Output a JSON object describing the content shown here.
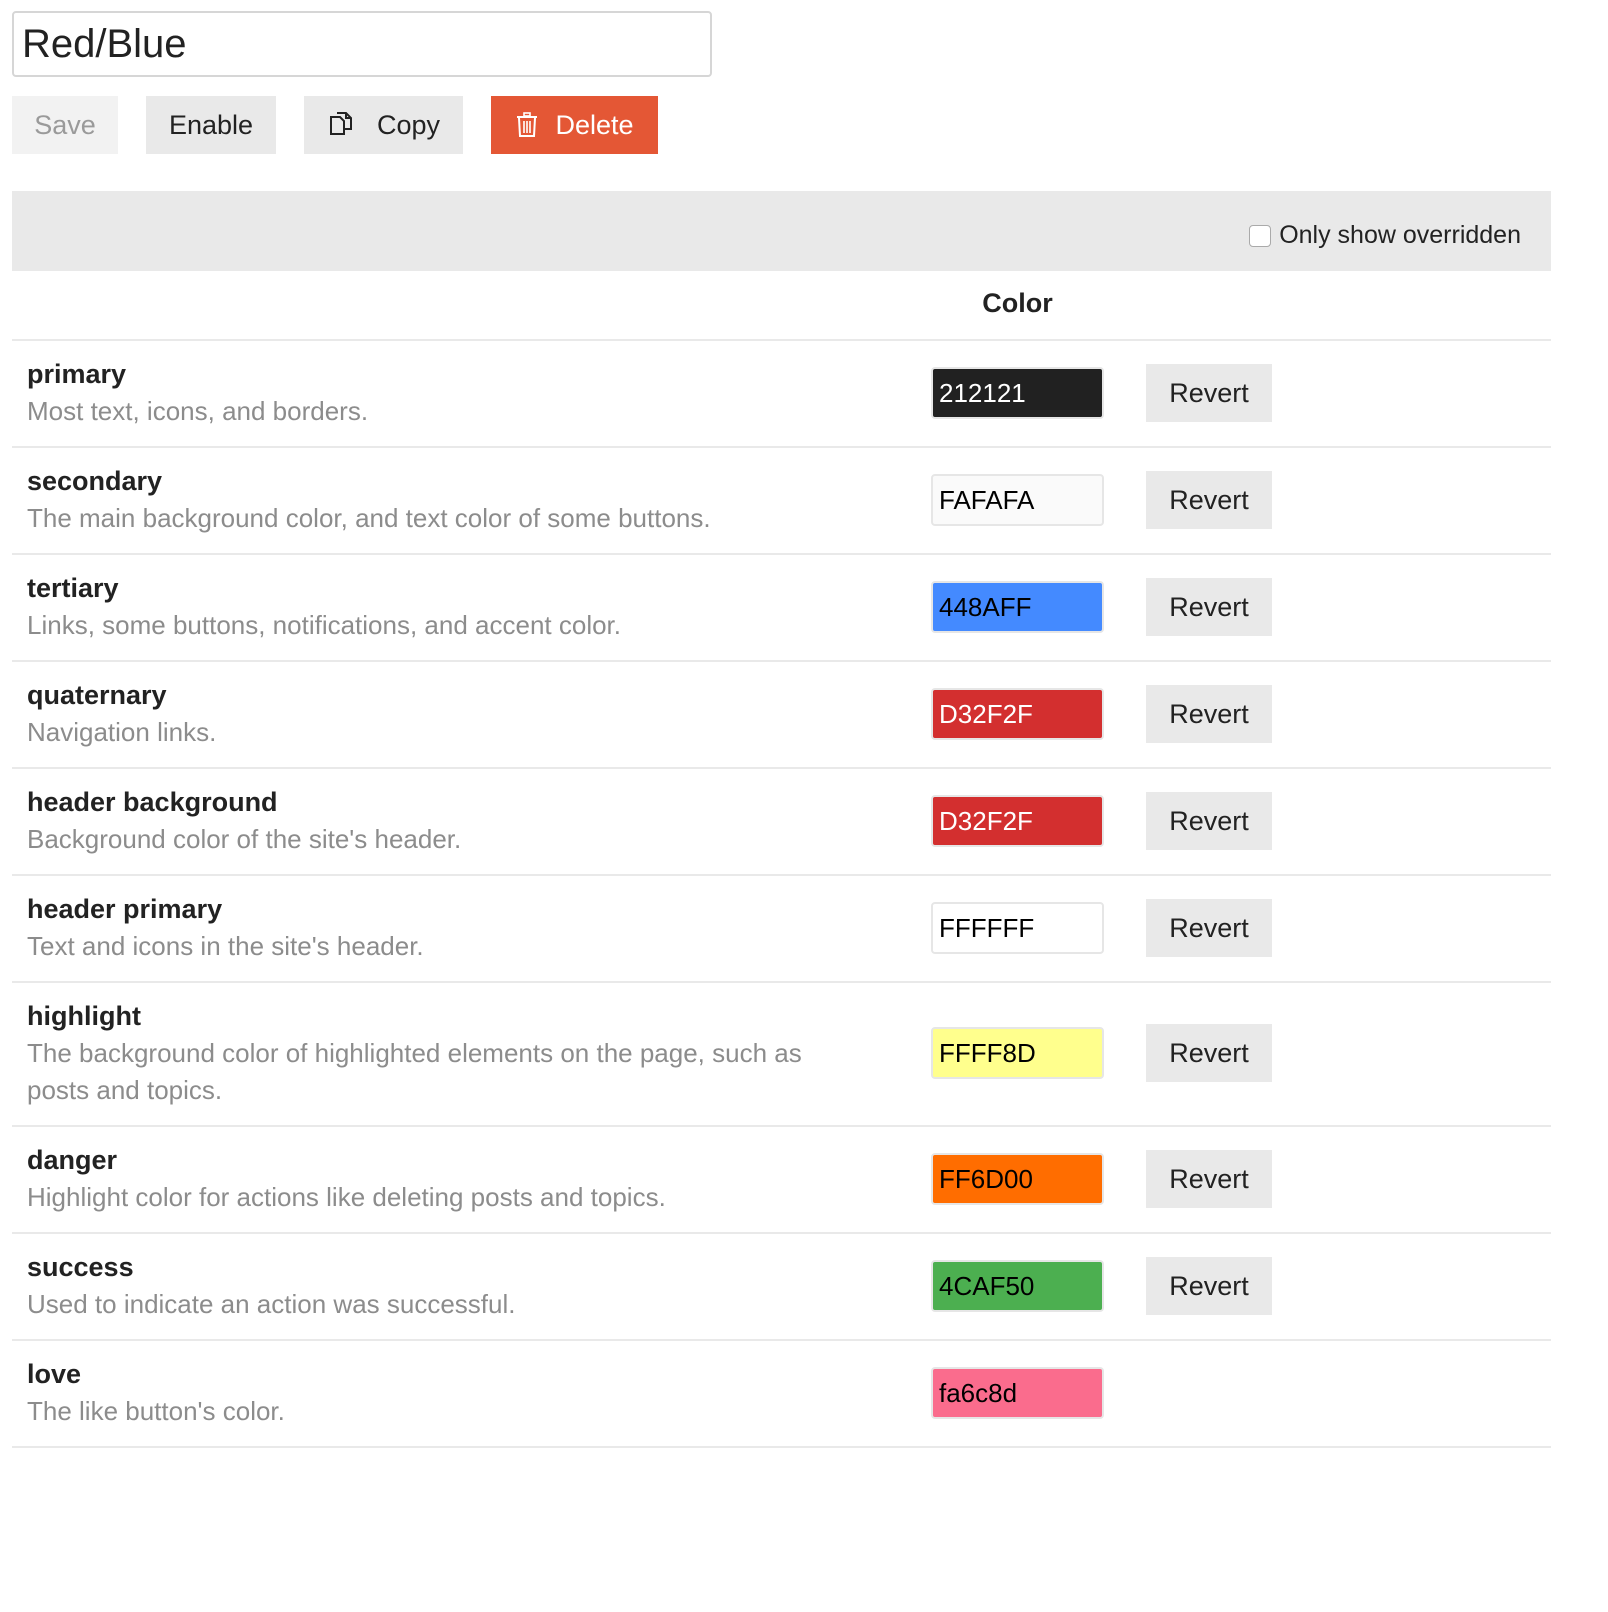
{
  "scheme": {
    "name": "Red/Blue"
  },
  "toolbar": {
    "save_label": "Save",
    "enable_label": "Enable",
    "copy_label": "Copy",
    "delete_label": "Delete"
  },
  "filter": {
    "only_overridden_label": "Only show overridden",
    "checked": false
  },
  "table": {
    "color_header": "Color"
  },
  "colors": [
    {
      "name": "primary",
      "desc": "Most text, icons, and borders.",
      "value": "212121",
      "bg": "#212121",
      "fg": "#ffffff",
      "revert": "Revert"
    },
    {
      "name": "secondary",
      "desc": "The main background color, and text color of some buttons.",
      "value": "FAFAFA",
      "bg": "#FAFAFA",
      "fg": "#000000",
      "revert": "Revert"
    },
    {
      "name": "tertiary",
      "desc": "Links, some buttons, notifications, and accent color.",
      "value": "448AFF",
      "bg": "#448AFF",
      "fg": "#000000",
      "revert": "Revert"
    },
    {
      "name": "quaternary",
      "desc": "Navigation links.",
      "value": "D32F2F",
      "bg": "#D32F2F",
      "fg": "#ffffff",
      "revert": "Revert"
    },
    {
      "name": "header background",
      "desc": "Background color of the site's header.",
      "value": "D32F2F",
      "bg": "#D32F2F",
      "fg": "#ffffff",
      "revert": "Revert"
    },
    {
      "name": "header primary",
      "desc": "Text and icons in the site's header.",
      "value": "FFFFFF",
      "bg": "#FFFFFF",
      "fg": "#000000",
      "revert": "Revert"
    },
    {
      "name": "highlight",
      "desc": "The background color of highlighted elements on the page, such as posts and topics.",
      "value": "FFFF8D",
      "bg": "#FFFF8D",
      "fg": "#000000",
      "revert": "Revert"
    },
    {
      "name": "danger",
      "desc": "Highlight color for actions like deleting posts and topics.",
      "value": "FF6D00",
      "bg": "#FF6D00",
      "fg": "#000000",
      "revert": "Revert"
    },
    {
      "name": "success",
      "desc": "Used to indicate an action was successful.",
      "value": "4CAF50",
      "bg": "#4CAF50",
      "fg": "#000000",
      "revert": "Revert"
    },
    {
      "name": "love",
      "desc": "The like button's color.",
      "value": "fa6c8d",
      "bg": "#fa6c8d",
      "fg": "#000000"
    }
  ]
}
